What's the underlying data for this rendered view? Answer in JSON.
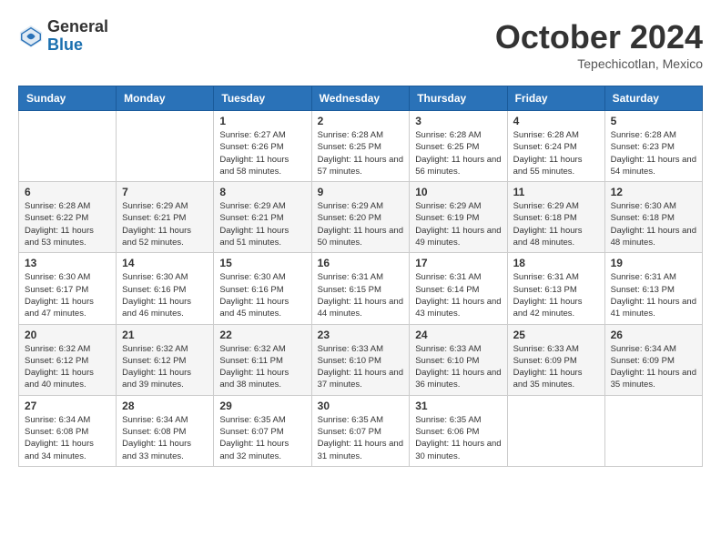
{
  "header": {
    "logo_general": "General",
    "logo_blue": "Blue",
    "month_title": "October 2024",
    "location": "Tepechicotlan, Mexico"
  },
  "weekdays": [
    "Sunday",
    "Monday",
    "Tuesday",
    "Wednesday",
    "Thursday",
    "Friday",
    "Saturday"
  ],
  "weeks": [
    [
      {
        "num": "",
        "info": ""
      },
      {
        "num": "",
        "info": ""
      },
      {
        "num": "1",
        "info": "Sunrise: 6:27 AM\nSunset: 6:26 PM\nDaylight: 11 hours and 58 minutes."
      },
      {
        "num": "2",
        "info": "Sunrise: 6:28 AM\nSunset: 6:25 PM\nDaylight: 11 hours and 57 minutes."
      },
      {
        "num": "3",
        "info": "Sunrise: 6:28 AM\nSunset: 6:25 PM\nDaylight: 11 hours and 56 minutes."
      },
      {
        "num": "4",
        "info": "Sunrise: 6:28 AM\nSunset: 6:24 PM\nDaylight: 11 hours and 55 minutes."
      },
      {
        "num": "5",
        "info": "Sunrise: 6:28 AM\nSunset: 6:23 PM\nDaylight: 11 hours and 54 minutes."
      }
    ],
    [
      {
        "num": "6",
        "info": "Sunrise: 6:28 AM\nSunset: 6:22 PM\nDaylight: 11 hours and 53 minutes."
      },
      {
        "num": "7",
        "info": "Sunrise: 6:29 AM\nSunset: 6:21 PM\nDaylight: 11 hours and 52 minutes."
      },
      {
        "num": "8",
        "info": "Sunrise: 6:29 AM\nSunset: 6:21 PM\nDaylight: 11 hours and 51 minutes."
      },
      {
        "num": "9",
        "info": "Sunrise: 6:29 AM\nSunset: 6:20 PM\nDaylight: 11 hours and 50 minutes."
      },
      {
        "num": "10",
        "info": "Sunrise: 6:29 AM\nSunset: 6:19 PM\nDaylight: 11 hours and 49 minutes."
      },
      {
        "num": "11",
        "info": "Sunrise: 6:29 AM\nSunset: 6:18 PM\nDaylight: 11 hours and 48 minutes."
      },
      {
        "num": "12",
        "info": "Sunrise: 6:30 AM\nSunset: 6:18 PM\nDaylight: 11 hours and 48 minutes."
      }
    ],
    [
      {
        "num": "13",
        "info": "Sunrise: 6:30 AM\nSunset: 6:17 PM\nDaylight: 11 hours and 47 minutes."
      },
      {
        "num": "14",
        "info": "Sunrise: 6:30 AM\nSunset: 6:16 PM\nDaylight: 11 hours and 46 minutes."
      },
      {
        "num": "15",
        "info": "Sunrise: 6:30 AM\nSunset: 6:16 PM\nDaylight: 11 hours and 45 minutes."
      },
      {
        "num": "16",
        "info": "Sunrise: 6:31 AM\nSunset: 6:15 PM\nDaylight: 11 hours and 44 minutes."
      },
      {
        "num": "17",
        "info": "Sunrise: 6:31 AM\nSunset: 6:14 PM\nDaylight: 11 hours and 43 minutes."
      },
      {
        "num": "18",
        "info": "Sunrise: 6:31 AM\nSunset: 6:13 PM\nDaylight: 11 hours and 42 minutes."
      },
      {
        "num": "19",
        "info": "Sunrise: 6:31 AM\nSunset: 6:13 PM\nDaylight: 11 hours and 41 minutes."
      }
    ],
    [
      {
        "num": "20",
        "info": "Sunrise: 6:32 AM\nSunset: 6:12 PM\nDaylight: 11 hours and 40 minutes."
      },
      {
        "num": "21",
        "info": "Sunrise: 6:32 AM\nSunset: 6:12 PM\nDaylight: 11 hours and 39 minutes."
      },
      {
        "num": "22",
        "info": "Sunrise: 6:32 AM\nSunset: 6:11 PM\nDaylight: 11 hours and 38 minutes."
      },
      {
        "num": "23",
        "info": "Sunrise: 6:33 AM\nSunset: 6:10 PM\nDaylight: 11 hours and 37 minutes."
      },
      {
        "num": "24",
        "info": "Sunrise: 6:33 AM\nSunset: 6:10 PM\nDaylight: 11 hours and 36 minutes."
      },
      {
        "num": "25",
        "info": "Sunrise: 6:33 AM\nSunset: 6:09 PM\nDaylight: 11 hours and 35 minutes."
      },
      {
        "num": "26",
        "info": "Sunrise: 6:34 AM\nSunset: 6:09 PM\nDaylight: 11 hours and 35 minutes."
      }
    ],
    [
      {
        "num": "27",
        "info": "Sunrise: 6:34 AM\nSunset: 6:08 PM\nDaylight: 11 hours and 34 minutes."
      },
      {
        "num": "28",
        "info": "Sunrise: 6:34 AM\nSunset: 6:08 PM\nDaylight: 11 hours and 33 minutes."
      },
      {
        "num": "29",
        "info": "Sunrise: 6:35 AM\nSunset: 6:07 PM\nDaylight: 11 hours and 32 minutes."
      },
      {
        "num": "30",
        "info": "Sunrise: 6:35 AM\nSunset: 6:07 PM\nDaylight: 11 hours and 31 minutes."
      },
      {
        "num": "31",
        "info": "Sunrise: 6:35 AM\nSunset: 6:06 PM\nDaylight: 11 hours and 30 minutes."
      },
      {
        "num": "",
        "info": ""
      },
      {
        "num": "",
        "info": ""
      }
    ]
  ]
}
